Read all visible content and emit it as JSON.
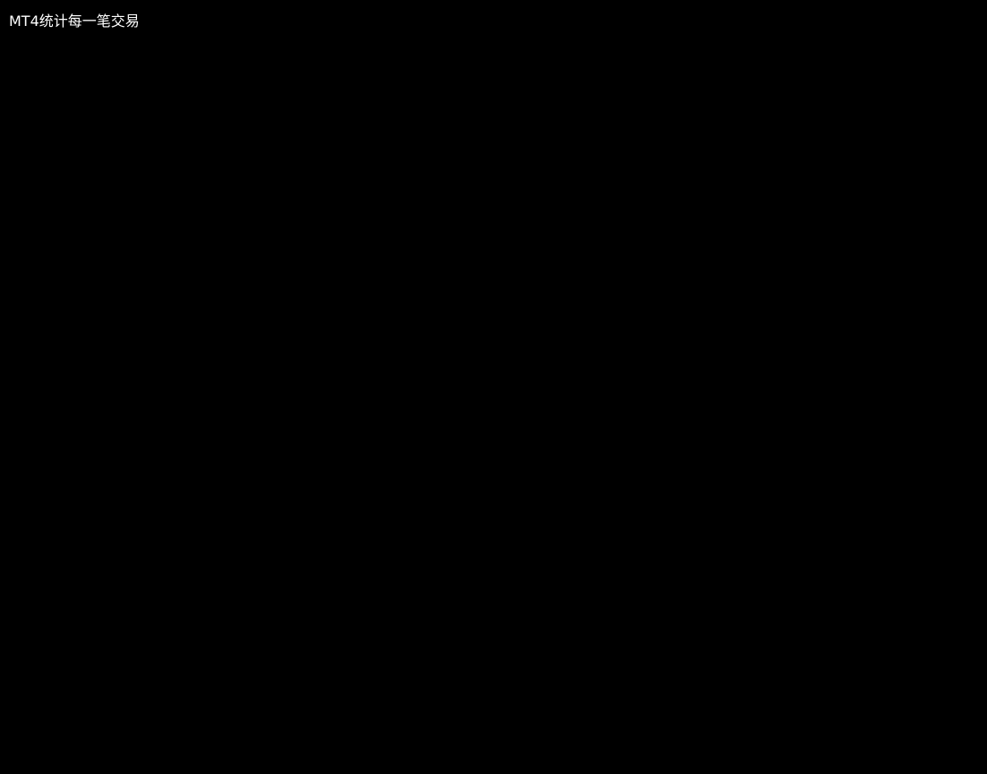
{
  "title": "MT4统计每一笔交易"
}
